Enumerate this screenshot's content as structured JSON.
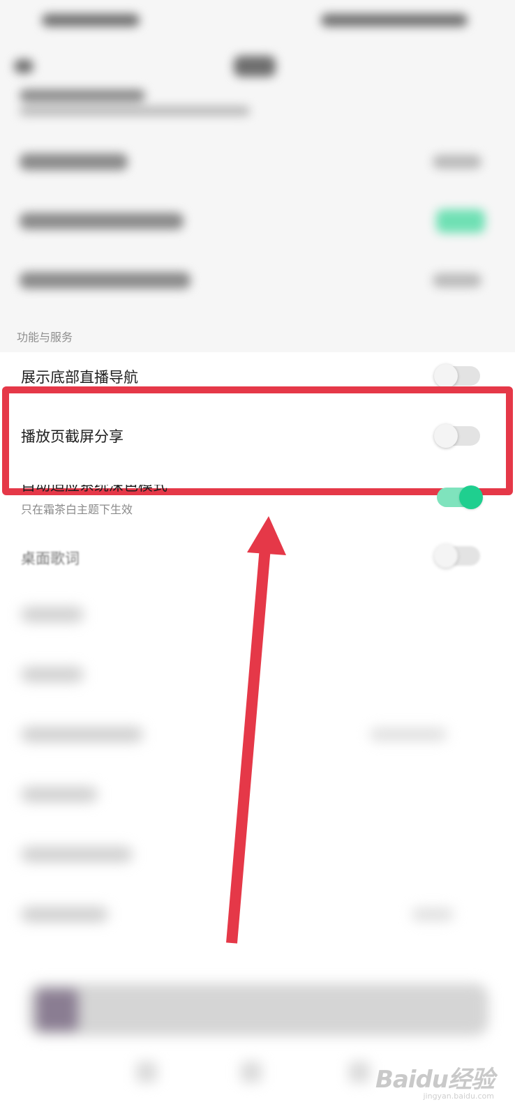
{
  "section": {
    "title": "功能与服务"
  },
  "rows": [
    {
      "label": "展示底部直播导航",
      "toggle_on": false
    },
    {
      "label": "播放页截屏分享",
      "toggle_on": false
    },
    {
      "label": "自动适应系统深色模式",
      "sub": "只在霜茶白主题下生效",
      "toggle_on": true
    },
    {
      "label": "桌面歌词",
      "toggle_on": false
    }
  ],
  "watermark": {
    "brand": "Baidu经验",
    "url": "jingyan.baidu.com"
  },
  "colors": {
    "accent": "#1fcf8f",
    "highlight": "#e53848"
  }
}
